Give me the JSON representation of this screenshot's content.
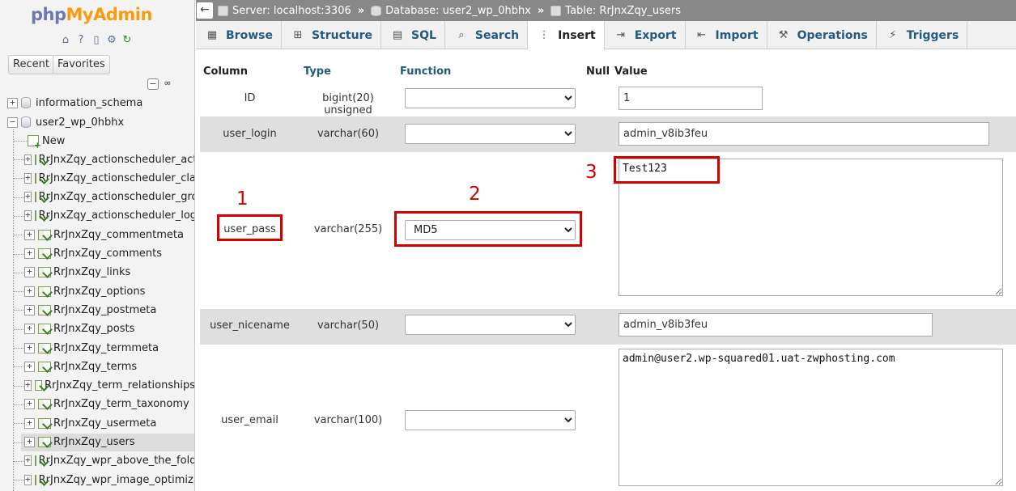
{
  "logo": {
    "part1": "php",
    "part2": "MyAdmin"
  },
  "nav": {
    "icons": [
      "home-icon",
      "help-icon",
      "docs-icon",
      "settings-icon",
      "reload-icon"
    ],
    "recent_label": "Recent",
    "favorites_label": "Favorites",
    "collapse_symbol": "−",
    "link_symbol": "∞",
    "databases": [
      {
        "name": "information_schema",
        "expander": "+"
      },
      {
        "name": "user2_wp_0hbhx",
        "expander": "−"
      }
    ],
    "new_label": "New",
    "tables": [
      "RrJnxZqy_actionscheduler_actions",
      "RrJnxZqy_actionscheduler_claims",
      "RrJnxZqy_actionscheduler_groups",
      "RrJnxZqy_actionscheduler_logs",
      "RrJnxZqy_commentmeta",
      "RrJnxZqy_comments",
      "RrJnxZqy_links",
      "RrJnxZqy_options",
      "RrJnxZqy_postmeta",
      "RrJnxZqy_posts",
      "RrJnxZqy_termmeta",
      "RrJnxZqy_terms",
      "RrJnxZqy_term_relationships",
      "RrJnxZqy_term_taxonomy",
      "RrJnxZqy_usermeta",
      "RrJnxZqy_users",
      "RrJnxZqy_wpr_above_the_fold",
      "RrJnxZqy_wpr_image_optimization"
    ],
    "selected_table": "RrJnxZqy_users"
  },
  "breadcrumb": {
    "back": "←",
    "server": "Server: localhost:3306",
    "database": "Database: user2_wp_0hbhx",
    "table": "Table: RrJnxZqy_users",
    "sep": "»"
  },
  "tabs": [
    {
      "label": "Browse",
      "icon": "▦",
      "active": false
    },
    {
      "label": "Structure",
      "icon": "⊞",
      "active": false
    },
    {
      "label": "SQL",
      "icon": "▤",
      "active": false
    },
    {
      "label": "Search",
      "icon": "⌕",
      "active": false
    },
    {
      "label": "Insert",
      "icon": "⋮",
      "active": true
    },
    {
      "label": "Export",
      "icon": "⇥",
      "active": false
    },
    {
      "label": "Import",
      "icon": "⇤",
      "active": false
    },
    {
      "label": "Operations",
      "icon": "⚒",
      "active": false
    },
    {
      "label": "Triggers",
      "icon": "⚡",
      "active": false
    }
  ],
  "table_header": {
    "column": "Column",
    "type": "Type",
    "function": "Function",
    "null": "Null",
    "value": "Value"
  },
  "rows": [
    {
      "column": "ID",
      "type": "bigint(20) unsigned",
      "function": "",
      "value": "1"
    },
    {
      "column": "user_login",
      "type": "varchar(60)",
      "function": "",
      "value": "admin_v8ib3feu"
    },
    {
      "column": "user_pass",
      "type": "varchar(255)",
      "function": "MD5",
      "value": "Test123"
    },
    {
      "column": "user_nicename",
      "type": "varchar(50)",
      "function": "",
      "value": "admin_v8ib3feu"
    },
    {
      "column": "user_email",
      "type": "varchar(100)",
      "function": "",
      "value": "admin@user2.wp-squared01.uat-zwphosting.com"
    }
  ],
  "annotations": {
    "a1": "1",
    "a2": "2",
    "a3": "3"
  },
  "colors": {
    "annotation": "#d40000",
    "link_blue": "#235a81",
    "topbar": "#888888"
  }
}
